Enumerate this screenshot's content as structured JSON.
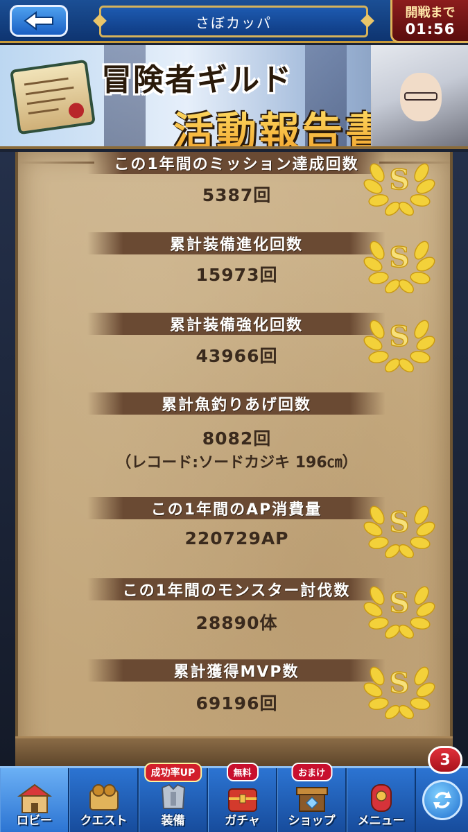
{
  "header": {
    "title": "さぼカッパ",
    "timer_label": "開戦まで",
    "timer_value": "01:56"
  },
  "banner": {
    "line1": "冒険者ギルド",
    "line2": "活動報告書"
  },
  "report": {
    "items": [
      {
        "label": "この1年間のミッション達成回数",
        "value": "5387回",
        "rank": "S"
      },
      {
        "label": "累計装備進化回数",
        "value": "15973回",
        "rank": "S"
      },
      {
        "label": "累計装備強化回数",
        "value": "43966回",
        "rank": "S"
      },
      {
        "label": "累計魚釣りあげ回数",
        "value": "8082回",
        "note": "（レコード:ソードカジキ 196㎝）"
      },
      {
        "label": "この1年間のAP消費量",
        "value": "220729AP",
        "rank": "S"
      },
      {
        "label": "この1年間のモンスター討伐数",
        "value": "28890体",
        "rank": "S"
      },
      {
        "label": "累計獲得MVP数",
        "value": "69196回",
        "rank": "S"
      }
    ]
  },
  "nav": {
    "lobby": "ロビー",
    "quest": "クエスト",
    "equip": "装備",
    "equip_tag": "成功率UP",
    "gacha": "ガチャ",
    "gacha_tag": "無料",
    "shop": "ショップ",
    "shop_tag": "おまけ",
    "menu": "メニュー",
    "refresh_badge": "3"
  },
  "colors": {
    "nav_blue": "#2c74d2",
    "parchment": "#c6ab80",
    "ribbon": "#6a4a33",
    "medal_gold": "#f3d13a"
  }
}
